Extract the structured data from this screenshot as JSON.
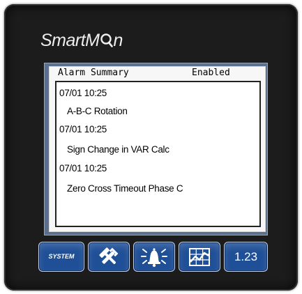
{
  "device": {
    "brand": "SmartMon",
    "brand_prefix": "SmartM",
    "brand_suffix": "n"
  },
  "screen": {
    "title": "Alarm Summary",
    "status": "Enabled",
    "alarms": [
      {
        "date": "07/01  10:25",
        "message": "A-B-C Rotation"
      },
      {
        "date": "07/01  10:25",
        "message": "Sign Change in VAR Calc"
      },
      {
        "date": "07/01  10:25",
        "message": "Zero Cross Timeout Phase C"
      }
    ]
  },
  "buttons": {
    "system_label": "SYSTEM",
    "tools_icon": "tools-icon",
    "alarm_icon": "alarm-bell-icon",
    "chart_icon": "chart-icon",
    "number_label": "1.23"
  },
  "colors": {
    "device_body": "#1c1c1c",
    "button_blue": "#1f4f96",
    "screen_bg": "#f7f7f7",
    "bezel": "#5b6f8f"
  }
}
